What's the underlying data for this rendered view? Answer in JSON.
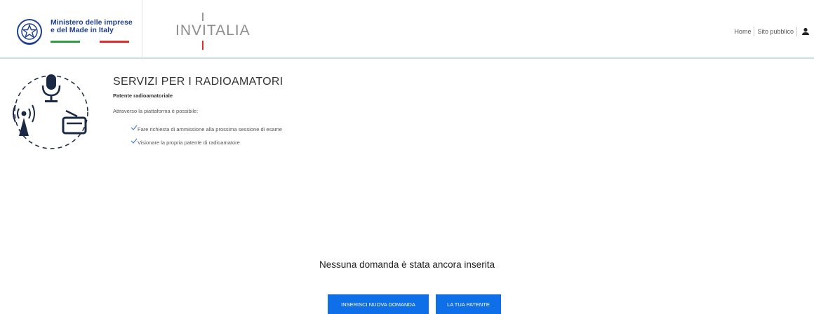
{
  "header": {
    "ministry_name": "Ministero delle imprese\ne del Made in Italy",
    "brand_name": "INVITALIA",
    "nav": {
      "home": "Home",
      "public_site": "Sito pubblico",
      "user_icon": "user-icon"
    }
  },
  "main": {
    "title": "SERVIZI PER I RADIOAMATORI",
    "subtitle": "Patente radioamatoriale",
    "intro": "Attraverso la piattaforma è possibile:",
    "features": [
      "Fare richiesta di ammissione alla prossima sessione di esame",
      "Visionare la propria patente di radioamatore"
    ],
    "empty_message": "Nessuna domanda è stata ancora inserita",
    "buttons": {
      "new_request": "Inserisci nuova domanda",
      "your_license": "La tua patente"
    }
  },
  "colors": {
    "primary_button": "#0f6fe8",
    "ministry_blue": "#1f3f8f",
    "flag_green": "#2e9e45",
    "flag_red": "#d9302c",
    "header_border": "#c9dbe9"
  }
}
